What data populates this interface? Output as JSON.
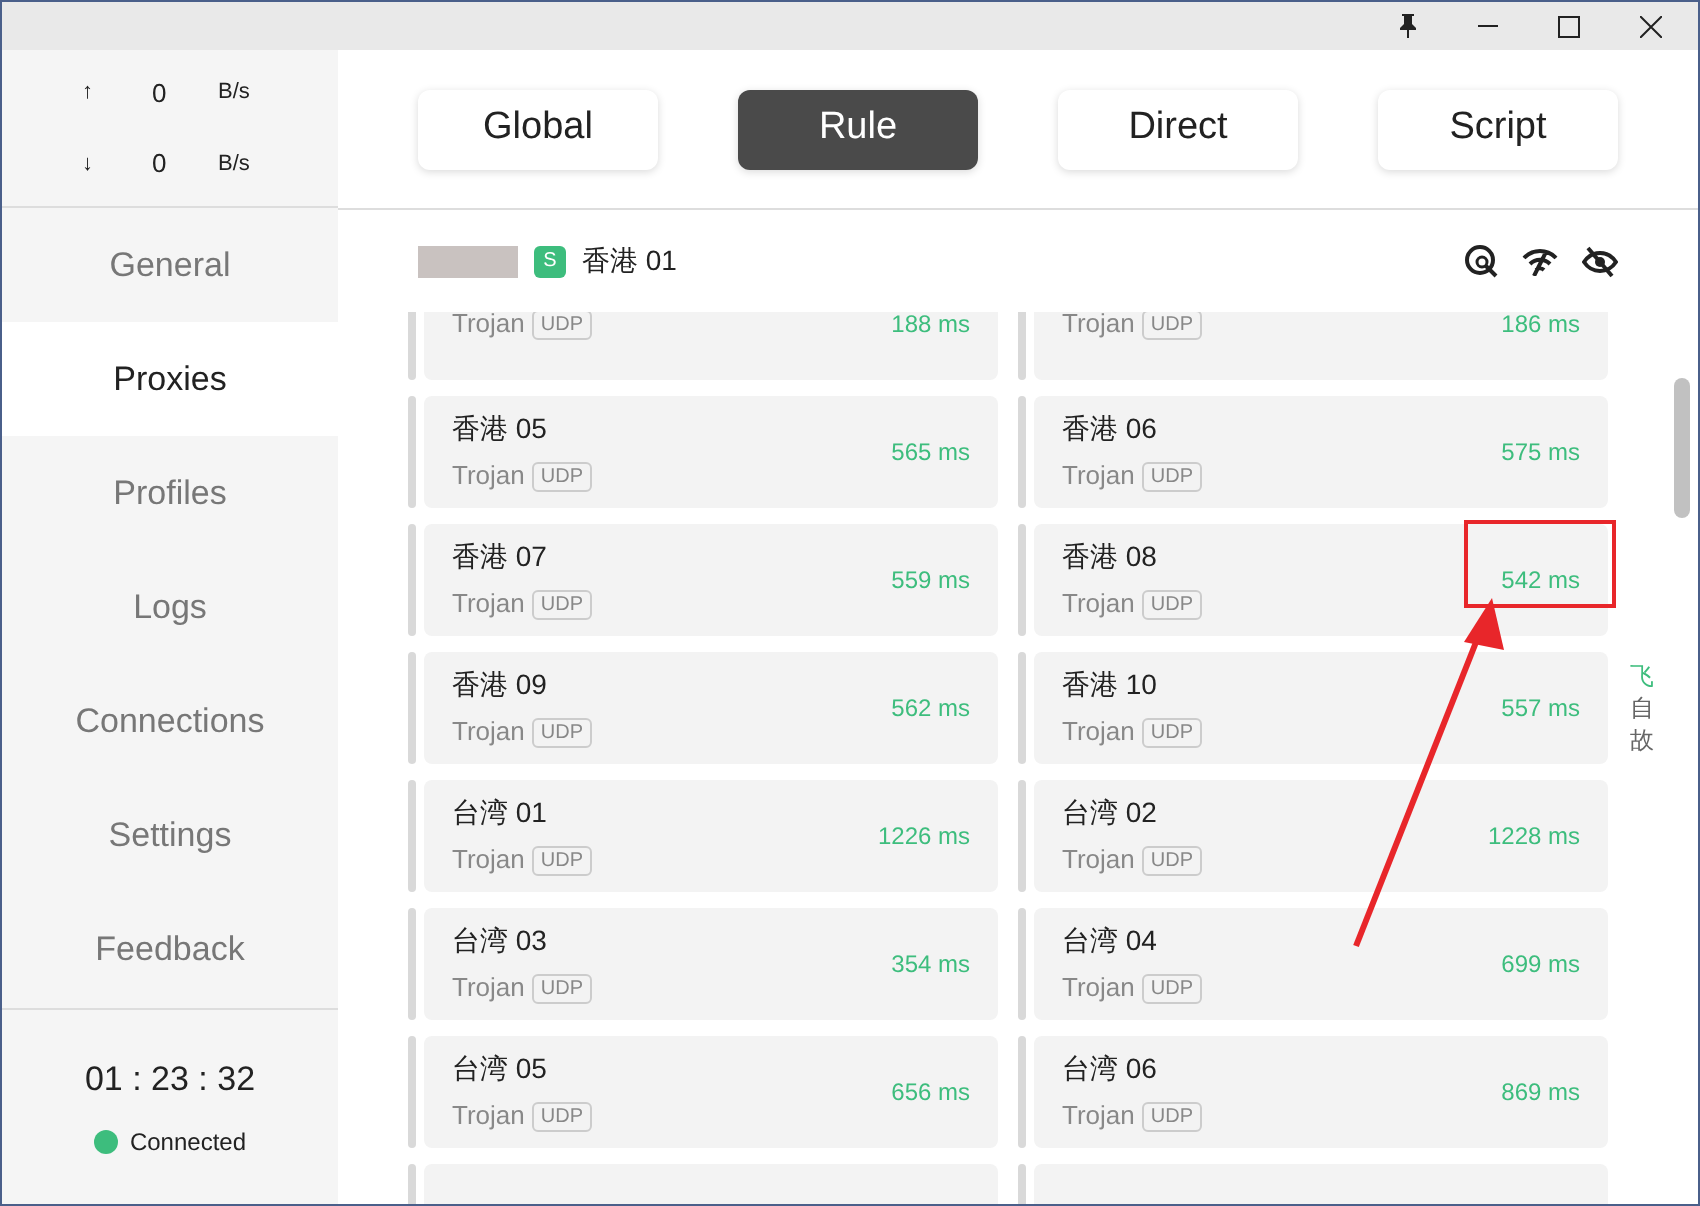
{
  "speed": [
    {
      "arrow": "↑",
      "value": "0",
      "unit": "B/s"
    },
    {
      "arrow": "↓",
      "value": "0",
      "unit": "B/s"
    }
  ],
  "nav": [
    {
      "label": "General",
      "selected": false
    },
    {
      "label": "Proxies",
      "selected": true
    },
    {
      "label": "Profiles",
      "selected": false
    },
    {
      "label": "Logs",
      "selected": false
    },
    {
      "label": "Connections",
      "selected": false
    },
    {
      "label": "Settings",
      "selected": false
    },
    {
      "label": "Feedback",
      "selected": false
    }
  ],
  "timer": "01 : 23 : 32",
  "status": {
    "label": "Connected",
    "color": "#3dbd7d"
  },
  "modes": [
    {
      "label": "Global",
      "selected": false
    },
    {
      "label": "Rule",
      "selected": true
    },
    {
      "label": "Direct",
      "selected": false
    },
    {
      "label": "Script",
      "selected": false
    }
  ],
  "group": {
    "badge": "S",
    "name": "香港 01"
  },
  "proxies": [
    {
      "type": "Trojan",
      "udp": "UDP",
      "latency": "188 ms"
    },
    {
      "type": "Trojan",
      "udp": "UDP",
      "latency": "186 ms"
    },
    {
      "name": "香港 05",
      "type": "Trojan",
      "udp": "UDP",
      "latency": "565 ms"
    },
    {
      "name": "香港 06",
      "type": "Trojan",
      "udp": "UDP",
      "latency": "575 ms"
    },
    {
      "name": "香港 07",
      "type": "Trojan",
      "udp": "UDP",
      "latency": "559 ms"
    },
    {
      "name": "香港 08",
      "type": "Trojan",
      "udp": "UDP",
      "latency": "542 ms",
      "highlighted": true
    },
    {
      "name": "香港 09",
      "type": "Trojan",
      "udp": "UDP",
      "latency": "562 ms"
    },
    {
      "name": "香港 10",
      "type": "Trojan",
      "udp": "UDP",
      "latency": "557 ms"
    },
    {
      "name": "台湾 01",
      "type": "Trojan",
      "udp": "UDP",
      "latency": "1226 ms"
    },
    {
      "name": "台湾 02",
      "type": "Trojan",
      "udp": "UDP",
      "latency": "1228 ms"
    },
    {
      "name": "台湾 03",
      "type": "Trojan",
      "udp": "UDP",
      "latency": "354 ms"
    },
    {
      "name": "台湾 04",
      "type": "Trojan",
      "udp": "UDP",
      "latency": "699 ms"
    },
    {
      "name": "台湾 05",
      "type": "Trojan",
      "udp": "UDP",
      "latency": "656 ms"
    },
    {
      "name": "台湾 06",
      "type": "Trojan",
      "udp": "UDP",
      "latency": "869 ms"
    }
  ],
  "side_chars": [
    {
      "char": "飞",
      "color": "#3dbd7d"
    },
    {
      "char": "自",
      "color": "#666666"
    },
    {
      "char": "故",
      "color": "#666666"
    }
  ]
}
